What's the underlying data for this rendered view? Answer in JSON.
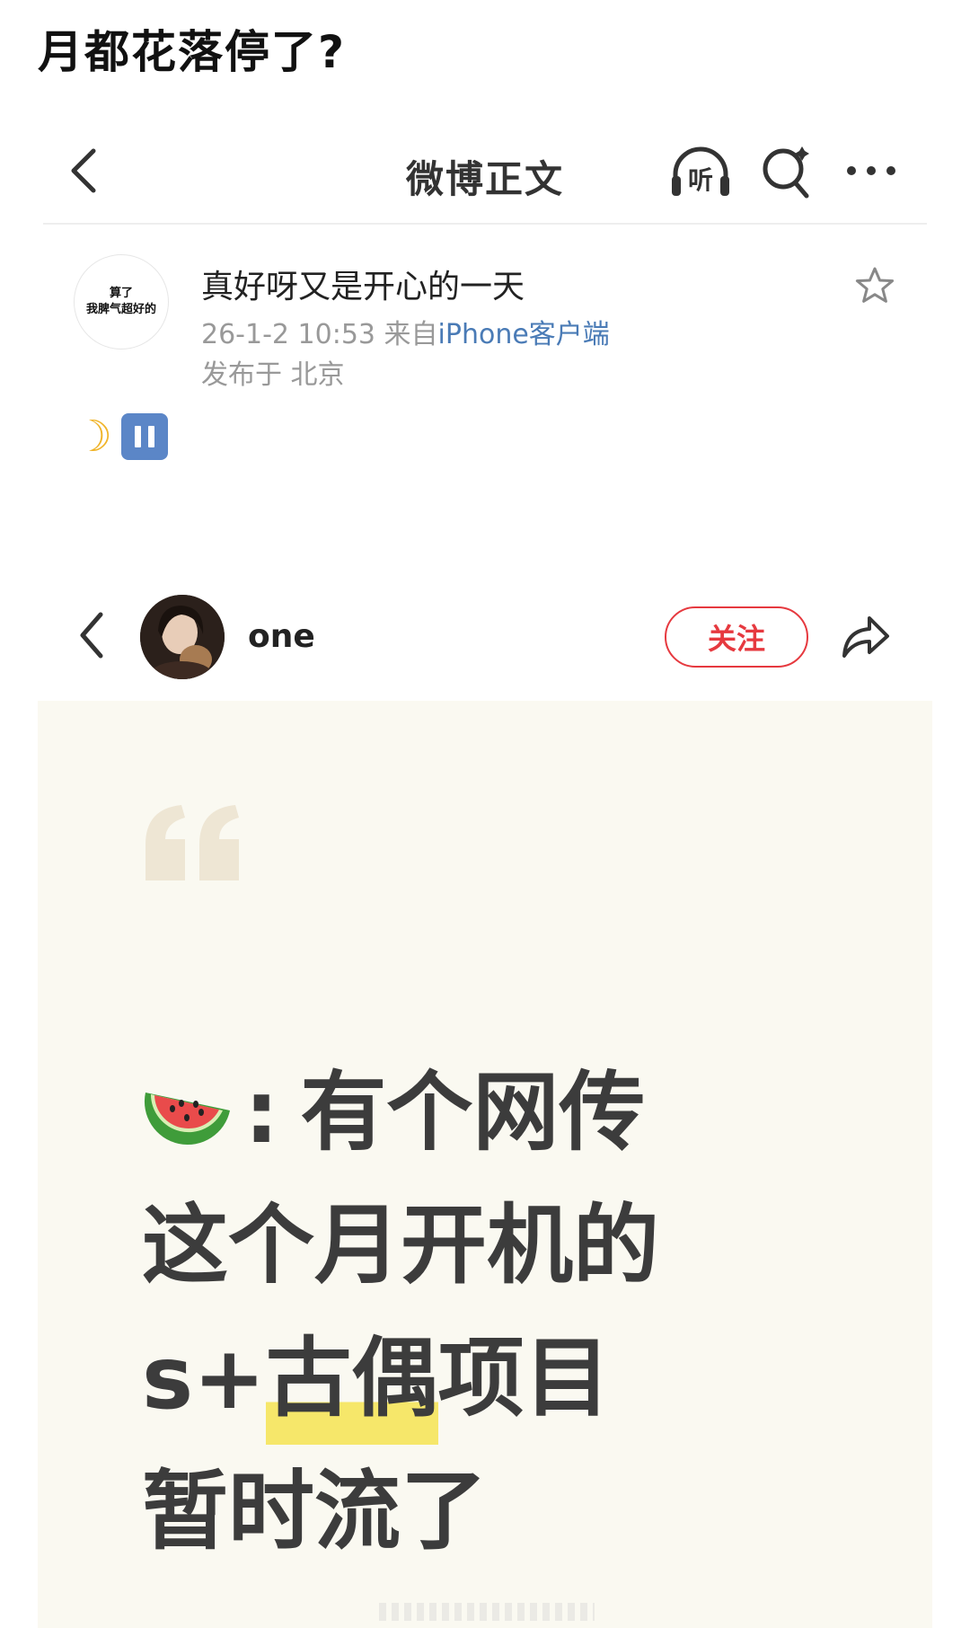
{
  "page_title": "月都花落停了?",
  "nav": {
    "title": "微博正文",
    "listen_label": "听"
  },
  "post": {
    "avatar_text": "算了\n我脾气超好的",
    "author": "真好呀又是开心的一天",
    "time": "26-1-2 10:53",
    "from_prefix": "来自",
    "source": "iPhone客户端",
    "location": "发布于 北京",
    "body_emojis": [
      "crescent-moon-emoji",
      "pause-button-emoji"
    ]
  },
  "profile": {
    "username": "one",
    "follow_label": "关注"
  },
  "card": {
    "colon": ":",
    "line1": "有个网传",
    "line2": "这个月开机的",
    "line3_prefix": "s+",
    "line3_highlight": "古偶",
    "line3_suffix": "项目",
    "line4": "暂时流了"
  },
  "colors": {
    "accent_red": "#e6393f",
    "link_blue": "#4a7bb6",
    "highlight_yellow": "#f6e76a",
    "card_bg": "#faf9f1"
  }
}
